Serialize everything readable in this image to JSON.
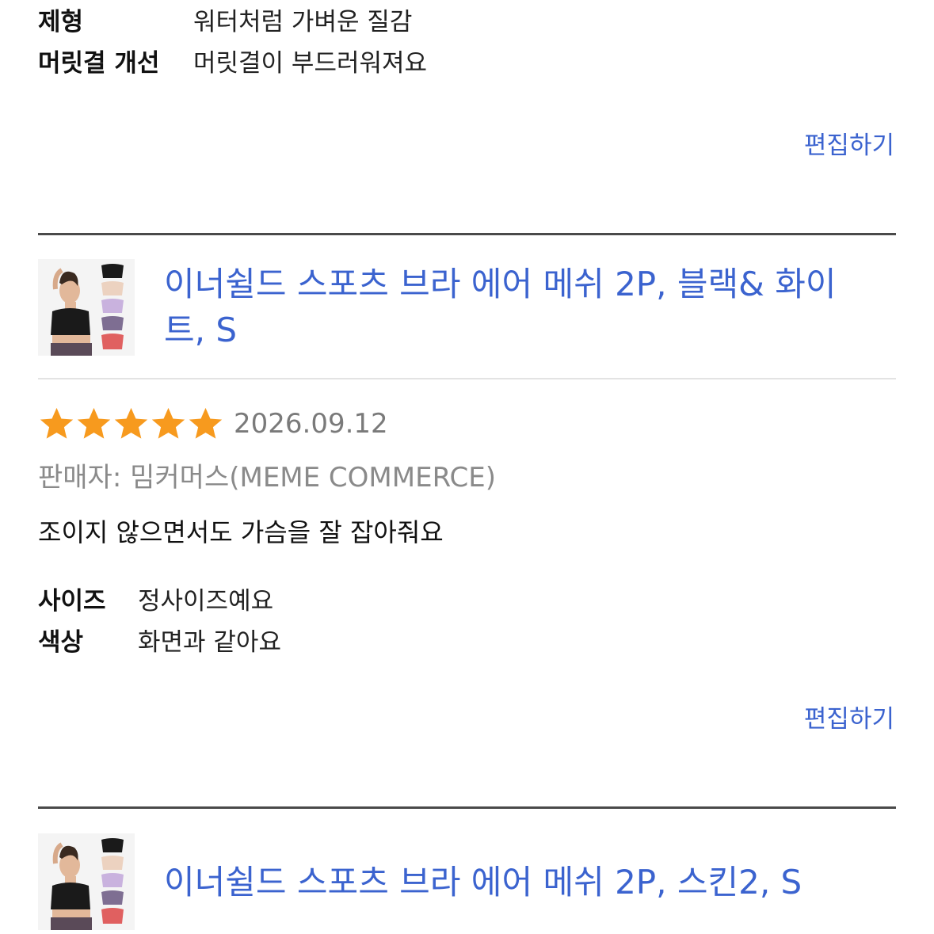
{
  "section1": {
    "attributes": [
      {
        "key": "제형",
        "value": "워터처럼 가벼운 질감"
      },
      {
        "key": "머릿결 개선",
        "value": "머릿결이 부드러워져요"
      }
    ],
    "edit_label": "편집하기"
  },
  "review1": {
    "product_title": "이너쉴드 스포츠 브라 에어 메쉬 2P, 블랙& 화이트, S",
    "rating": 5,
    "date": "2026.09.12",
    "seller": "판매자: 밈커머스(MEME COMMERCE)",
    "review_text": "조이지 않으면서도 가슴을 잘 잡아줘요",
    "attributes": [
      {
        "key": "사이즈",
        "value": "정사이즈예요"
      },
      {
        "key": "색상",
        "value": "화면과 같아요"
      }
    ],
    "edit_label": "편집하기"
  },
  "review2": {
    "product_title": "이너쉴드 스포츠 브라 에어 메쉬 2P, 스킨2, S"
  },
  "colors": {
    "link_blue": "#3b63cf",
    "star_orange": "#f79a1e",
    "divider": "#4a4a4a"
  }
}
